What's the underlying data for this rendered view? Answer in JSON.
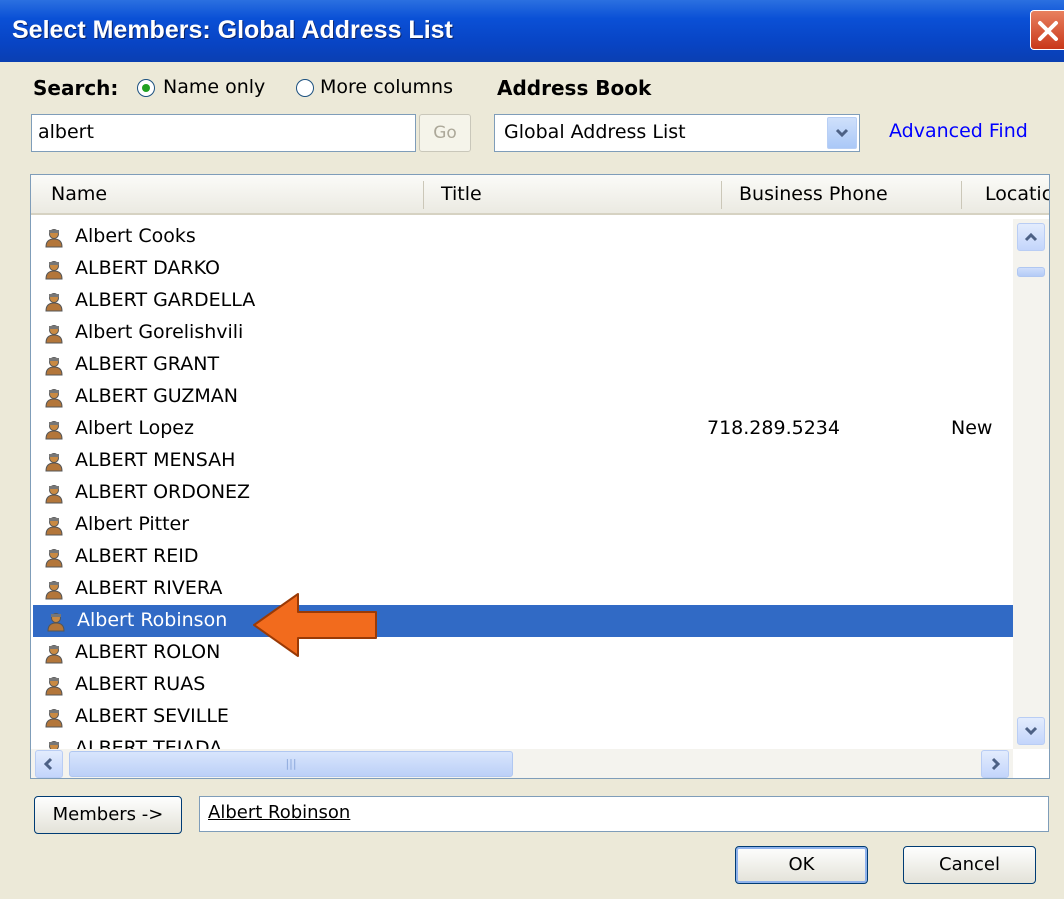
{
  "window": {
    "title": "Select Members: Global Address List"
  },
  "search": {
    "label": "Search:",
    "options": [
      {
        "label": "Name only",
        "checked": true
      },
      {
        "label": "More columns",
        "checked": false
      }
    ],
    "value": "albert",
    "go_label": "Go"
  },
  "address_book": {
    "label": "Address Book",
    "selected": "Global Address List",
    "advanced_find": "Advanced Find"
  },
  "columns": [
    "Name",
    "Title",
    "Business Phone",
    "Locatic"
  ],
  "rows": [
    {
      "name": "Albert Cooks",
      "phone": "",
      "location": ""
    },
    {
      "name": "ALBERT DARKO",
      "phone": "",
      "location": ""
    },
    {
      "name": "ALBERT GARDELLA",
      "phone": "",
      "location": ""
    },
    {
      "name": "Albert Gorelishvili",
      "phone": "",
      "location": ""
    },
    {
      "name": "ALBERT GRANT",
      "phone": "",
      "location": ""
    },
    {
      "name": "ALBERT GUZMAN",
      "phone": "",
      "location": ""
    },
    {
      "name": "Albert Lopez",
      "phone": "718.289.5234",
      "location": "New"
    },
    {
      "name": "ALBERT MENSAH",
      "phone": "",
      "location": ""
    },
    {
      "name": "ALBERT ORDONEZ",
      "phone": "",
      "location": ""
    },
    {
      "name": "Albert Pitter",
      "phone": "",
      "location": ""
    },
    {
      "name": "ALBERT REID",
      "phone": "",
      "location": ""
    },
    {
      "name": "ALBERT RIVERA",
      "phone": "",
      "location": ""
    },
    {
      "name": "Albert Robinson",
      "phone": "",
      "location": "",
      "selected": true
    },
    {
      "name": "ALBERT ROLON",
      "phone": "",
      "location": ""
    },
    {
      "name": "ALBERT RUAS",
      "phone": "",
      "location": ""
    },
    {
      "name": "ALBERT SEVILLE",
      "phone": "",
      "location": ""
    },
    {
      "name": "ALBERT TEJADA",
      "phone": "",
      "location": ""
    }
  ],
  "members": {
    "button_label": "Members ->",
    "value": "Albert Robinson"
  },
  "buttons": {
    "ok": "OK",
    "cancel": "Cancel"
  },
  "colors": {
    "selection": "#316ac5",
    "annotation_arrow": "#f26b1d",
    "titlebar": "#0a50d6"
  }
}
